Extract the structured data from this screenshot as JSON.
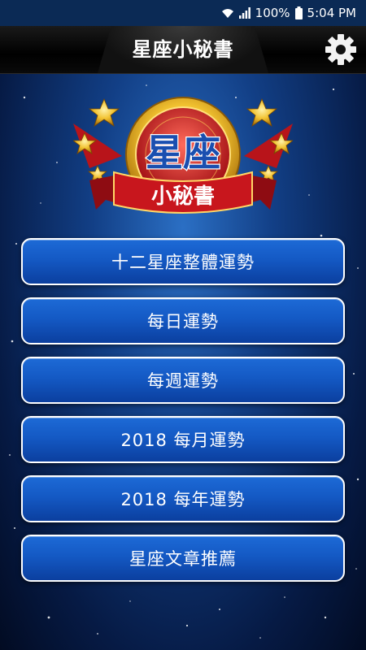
{
  "status_bar": {
    "battery": "100%",
    "time": "5:04 PM",
    "icons": [
      "wifi-icon",
      "signal-icon",
      "battery-icon"
    ]
  },
  "app_bar": {
    "title": "星座小秘書",
    "settings_icon": "gear-icon"
  },
  "logo": {
    "line1": "星座",
    "line2": "小秘書"
  },
  "menu": {
    "items": [
      {
        "label": "十二星座整體運勢"
      },
      {
        "label": "每日運勢"
      },
      {
        "label": "每週運勢"
      },
      {
        "label": "2018 每月運勢"
      },
      {
        "label": "2018 每年運勢"
      },
      {
        "label": "星座文章推薦"
      }
    ]
  },
  "colors": {
    "button_top": "#1d6ad6",
    "button_bottom": "#0b3f9f",
    "ribbon": "#c8161d",
    "gold": "#f2c230"
  }
}
